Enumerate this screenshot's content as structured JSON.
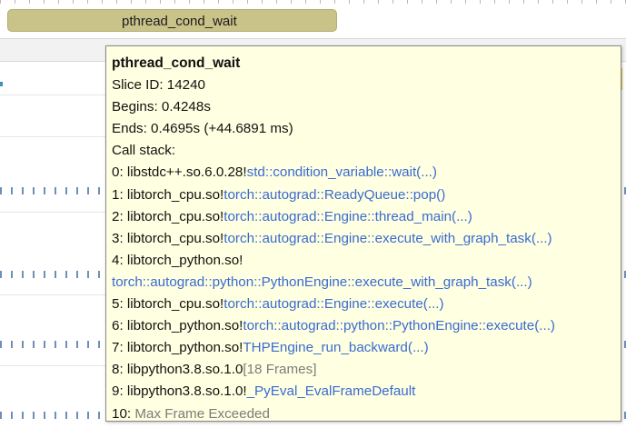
{
  "slice_bar": {
    "label": "pthread_cond_wait"
  },
  "tooltip": {
    "title": "pthread_cond_wait",
    "slice_id": "Slice ID: 14240",
    "begins": "Begins: 0.4248s",
    "ends": "Ends: 0.4695s (+44.6891 ms)",
    "call_stack_label": "Call stack:",
    "frames": [
      {
        "prefix": "0: libstdc++.so.6.0.28!",
        "symbol": "std::condition_variable::wait(...)",
        "style": "link"
      },
      {
        "prefix": "1: libtorch_cpu.so!",
        "symbol": "torch::autograd::ReadyQueue::pop()",
        "style": "link"
      },
      {
        "prefix": "2: libtorch_cpu.so!",
        "symbol": "torch::autograd::Engine::thread_main(...)",
        "style": "link"
      },
      {
        "prefix": "3: libtorch_cpu.so!",
        "symbol": "torch::autograd::Engine::execute_with_graph_task(...)",
        "style": "link"
      },
      {
        "prefix": "4: libtorch_python.so!",
        "symbol": "",
        "style": "link"
      },
      {
        "prefix": "",
        "symbol": "torch::autograd::python::PythonEngine::execute_with_graph_task(...)",
        "style": "link"
      },
      {
        "prefix": "5: libtorch_cpu.so!",
        "symbol": "torch::autograd::Engine::execute(...)",
        "style": "link"
      },
      {
        "prefix": "6: libtorch_python.so!",
        "symbol": "torch::autograd::python::PythonEngine::execute(...)",
        "style": "link"
      },
      {
        "prefix": "7: libtorch_python.so!",
        "symbol": "THPEngine_run_backward(...)",
        "style": "link"
      },
      {
        "prefix": "8: libpython3.8.so.1.0",
        "symbol": "[18 Frames]",
        "style": "muted"
      },
      {
        "prefix": "9: libpython3.8.so.1.0!",
        "symbol": "_PyEval_EvalFrameDefault",
        "style": "link"
      },
      {
        "prefix": "10: ",
        "symbol": "Max Frame Exceeded",
        "style": "muted"
      }
    ]
  },
  "colors": {
    "tooltip_bg": "#ffffe1",
    "link": "#3a6bd1",
    "muted": "#7c7c7c",
    "slice_bar": "#c9c289"
  }
}
